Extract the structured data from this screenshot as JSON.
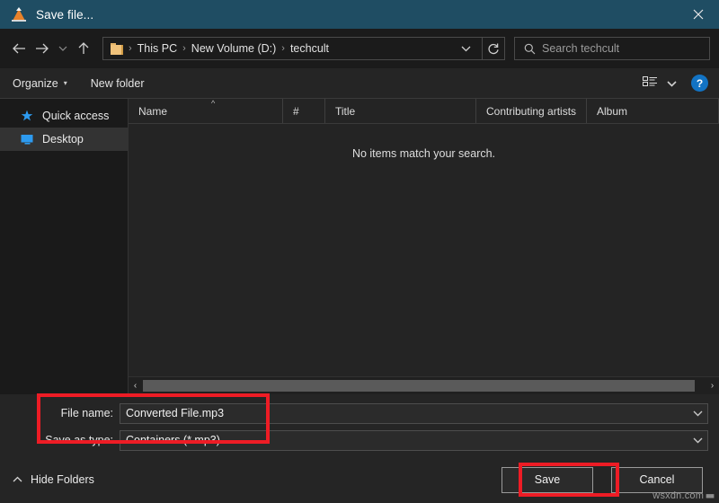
{
  "window": {
    "title": "Save file...",
    "app_icon": "vlc-cone-icon",
    "close_label": "×",
    "titlebar_color": "#1f4d63"
  },
  "navigation": {
    "back_icon": "arrow-left-icon",
    "forward_icon": "arrow-right-icon",
    "recent_icon": "chevron-down-icon",
    "up_icon": "arrow-up-icon",
    "refresh_icon": "refresh-icon",
    "address_chevron_icon": "chevron-down-icon",
    "breadcrumbs": [
      "This PC",
      "New Volume (D:)",
      "techcult"
    ],
    "separator": "›"
  },
  "search": {
    "placeholder": "Search techcult",
    "icon": "search-icon"
  },
  "toolbar": {
    "organize_label": "Organize",
    "organize_caret": "▾",
    "new_folder_label": "New folder",
    "view_icon": "list-view-icon",
    "view_caret_icon": "chevron-down-icon",
    "help_label": "?"
  },
  "sidebar": {
    "items": [
      {
        "label": "Quick access",
        "icon": "star-icon",
        "selected": false
      },
      {
        "label": "Desktop",
        "icon": "monitor-icon",
        "selected": true
      }
    ]
  },
  "filelist": {
    "columns": [
      {
        "label": "Name",
        "sort": "ascending"
      },
      {
        "label": "#"
      },
      {
        "label": "Title"
      },
      {
        "label": "Contributing artists"
      },
      {
        "label": "Album"
      }
    ],
    "empty_message": "No items match your search.",
    "scrollbar": {
      "left_arrow": "‹",
      "right_arrow": "›"
    }
  },
  "form": {
    "file_name_label": "File name:",
    "file_name_value": "Converted File.mp3",
    "save_as_type_label": "Save as type:",
    "save_as_type_value": "Containers (*.mp3)",
    "dropdown_icon": "chevron-down-icon"
  },
  "footer": {
    "hide_folders_label": "Hide Folders",
    "hide_folders_caret": "chevron-up-icon",
    "save_label": "Save",
    "cancel_label": "Cancel"
  },
  "annotations": {
    "color": "#ee1c25",
    "fields_box": "file-name-and-type-highlight",
    "save_box": "save-button-highlight"
  },
  "watermark": {
    "text": "wsxdn.com"
  }
}
